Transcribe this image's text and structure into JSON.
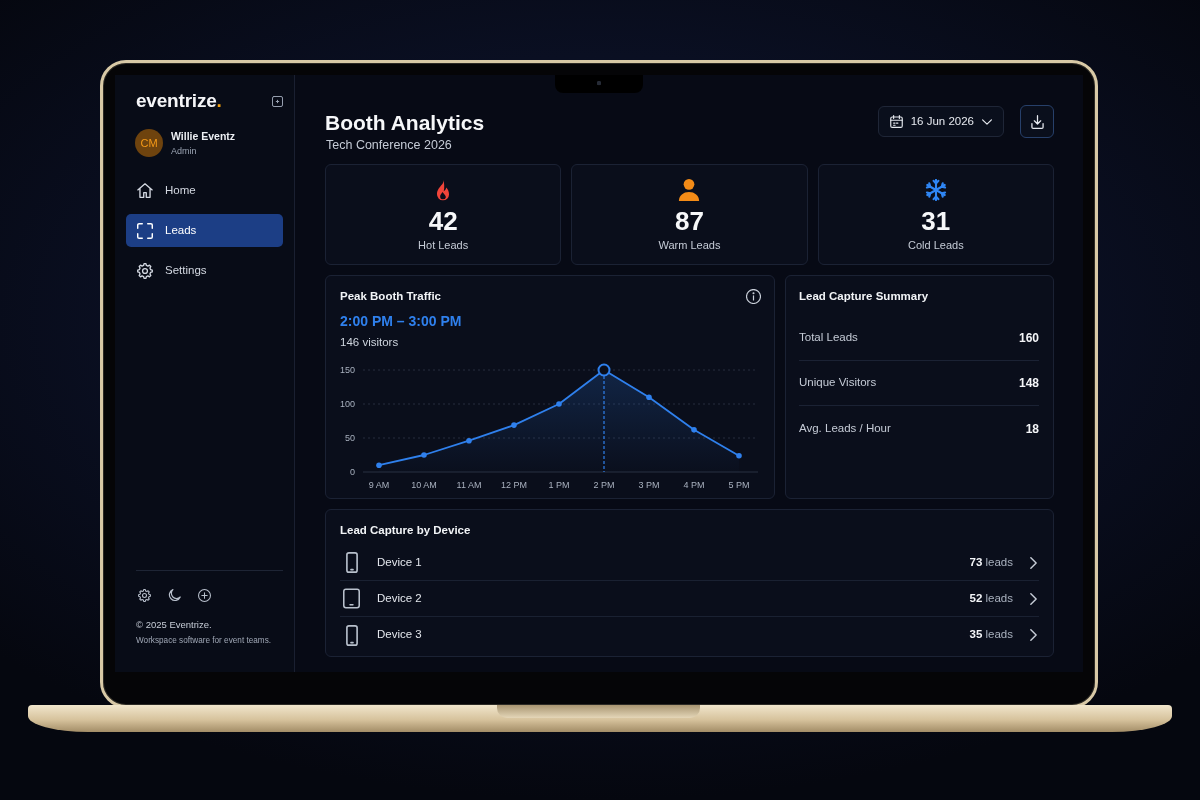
{
  "sidebar": {
    "logo": {
      "text": "eventrize",
      "accent": "."
    },
    "user": {
      "initials": "CM",
      "name": "Willie Eventz",
      "role": "Admin"
    },
    "nav": [
      {
        "label": "Home",
        "kind": "home",
        "selected": false
      },
      {
        "label": "Leads",
        "kind": "leads",
        "selected": true
      },
      {
        "label": "Settings",
        "kind": "settings",
        "selected": false
      }
    ],
    "footer": {
      "copyright": "© 2025 Eventrize.",
      "tagline": "Workspace software for event teams."
    }
  },
  "header": {
    "title": "Booth Analytics",
    "subtitle": "Tech Conference 2026",
    "date": "16 Jun 2026"
  },
  "stats": [
    {
      "kind": "hot",
      "color": "#f0443a",
      "value": "42",
      "label": "Hot Leads"
    },
    {
      "kind": "warm",
      "color": "#f38b17",
      "value": "87",
      "label": "Warm Leads"
    },
    {
      "kind": "cold",
      "color": "#2f86f5",
      "value": "31",
      "label": "Cold Leads"
    }
  ],
  "traffic": {
    "title": "Peak Booth Traffic",
    "peak_time": "2:00 PM – 3:00 PM",
    "peak_visitors": "146 visitors",
    "chart_data": {
      "type": "area",
      "categories": [
        "9 AM",
        "10 AM",
        "11 AM",
        "12 PM",
        "1 PM",
        "2 PM",
        "3 PM",
        "4 PM",
        "5 PM"
      ],
      "series": [
        {
          "color": "#2f80ed",
          "values": [
            10,
            25,
            46,
            69,
            100,
            150,
            110,
            62,
            24
          ]
        }
      ],
      "ylim": [
        0,
        150
      ],
      "yticks": [
        0,
        50,
        100,
        150
      ],
      "ref_lines": [
        {
          "axis": "x",
          "value": "2 PM"
        }
      ]
    }
  },
  "summary": {
    "title": "Lead Capture Summary",
    "rows": [
      {
        "label": "Total Leads",
        "value": "160"
      },
      {
        "label": "Unique Visitors",
        "value": "148"
      },
      {
        "label": "Avg. Leads / Hour",
        "value": "18"
      }
    ]
  },
  "devices": {
    "title": "Lead Capture by Device",
    "rows": [
      {
        "kind": "phone",
        "name": "Device 1",
        "count": "73",
        "unit": "leads"
      },
      {
        "kind": "tablet",
        "name": "Device 2",
        "count": "52",
        "unit": "leads"
      },
      {
        "kind": "phone",
        "name": "Device 3",
        "count": "35",
        "unit": "leads"
      }
    ]
  }
}
